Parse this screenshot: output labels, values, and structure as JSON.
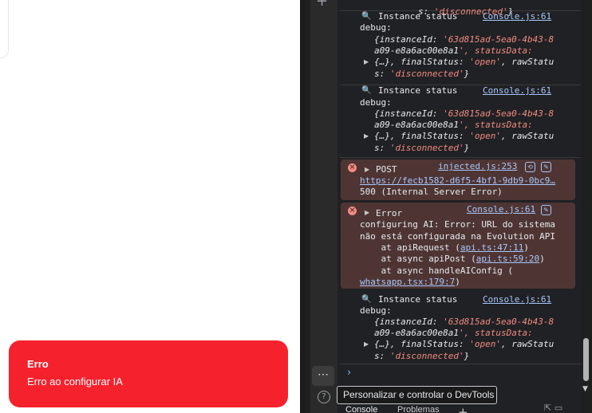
{
  "toast": {
    "title": "Erro",
    "description": "Erro ao configurar IA"
  },
  "devtools": {
    "sidebar": {
      "add_label": "+",
      "more_label": "⋯",
      "help_label": "?"
    },
    "tooltip": "Personalizar e controlar o DevTools",
    "prompt_symbol": "›",
    "drawer": {
      "tabs": [
        "Console",
        "Problemas"
      ],
      "add_tab": "+"
    },
    "console": {
      "messages": [
        {
          "type": "log",
          "head": "",
          "source": "",
          "lines": [
            "s: 'disconnected'}"
          ]
        },
        {
          "type": "log",
          "head": "Instance status",
          "source": "Console.js:61",
          "label": "debug:",
          "obj": [
            "{instanceId: '63d815ad-5ea0-4b43-8",
            "a09-e8a6ac00e8a1', statusData:",
            "{…}, finalStatus: 'open', rawStatu",
            "s: 'disconnected'}"
          ]
        },
        {
          "type": "log",
          "head": "Instance status",
          "source": "Console.js:61",
          "label": "debug:",
          "obj": [
            "{instanceId: '63d815ad-5ea0-4b43-8",
            "a09-e8a6ac00e8a1', statusData:",
            "{…}, finalStatus: 'open', rawStatu",
            "s: 'disconnected'}"
          ]
        },
        {
          "type": "error",
          "head": "POST",
          "source": "injected.js:253",
          "url": "https://fecb1582-d6f5-4bf1-9db9-0bc9…",
          "detail": "500 (Internal Server Error)"
        },
        {
          "type": "error",
          "head": "Error",
          "source": "Console.js:61",
          "lines": [
            "configuring AI: Error: URL do sistema",
            "não está configurada na Evolution API"
          ],
          "stack": [
            {
              "prefix": "    at apiRequest (",
              "link": "api.ts:47:11",
              "suffix": ")"
            },
            {
              "prefix": "    at async apiPost (",
              "link": "api.ts:59:20",
              "suffix": ")"
            },
            {
              "prefix": "    at async handleAIConfig (",
              "link": "",
              "suffix": ""
            }
          ],
          "stack_tail_link": "whatsapp.tsx:179:7",
          "stack_tail_suffix": ")"
        },
        {
          "type": "log",
          "head": "Instance status",
          "source": "Console.js:61",
          "label": "debug:",
          "obj": [
            "{instanceId: '63d815ad-5ea0-4b43-8",
            "a09-e8a6ac00e8a1', statusData:",
            "{…}, finalStatus: 'open', rawStatu",
            "s: 'disconnected'}"
          ]
        }
      ]
    }
  },
  "colors": {
    "toast_bg": "#f5222d",
    "devtools_bg": "#202124",
    "error_bg": "#4e3534",
    "link": "#a8c7fa",
    "string": "#f28b82"
  }
}
